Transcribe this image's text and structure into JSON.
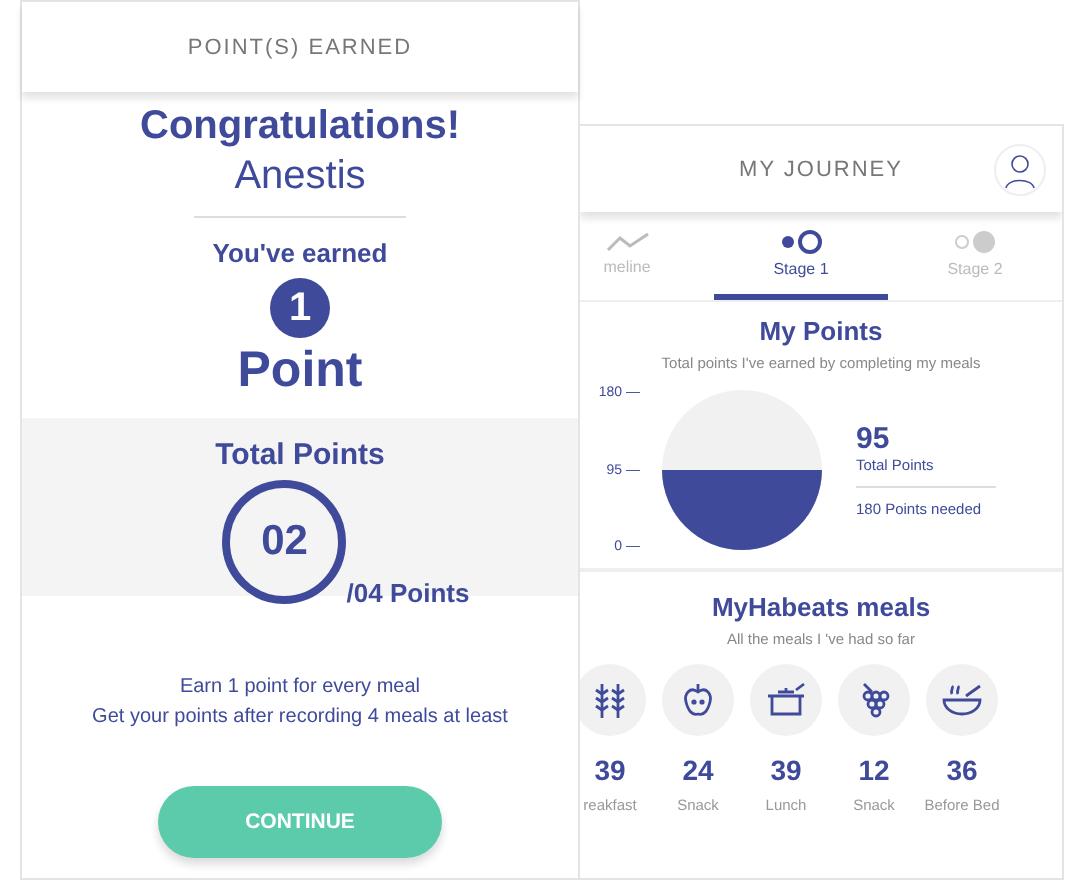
{
  "earned_card": {
    "header": "POINT(S) EARNED",
    "title": "Congratulations!",
    "name": "Anestis",
    "earned_label": "You've earned",
    "earned_count": "1",
    "earned_unit": "Point",
    "total": {
      "title": "Total Points",
      "value": "02",
      "suffix": "/04 Points"
    },
    "info": [
      "Earn 1 point for every meal",
      "Get your points after recording 4 meals at least"
    ],
    "button": "CONTINUE"
  },
  "journey_card": {
    "header": "MY JOURNEY",
    "tabs": [
      {
        "label": "meline",
        "selected": false
      },
      {
        "label": "Stage 1",
        "selected": true
      },
      {
        "label": "Stage 2",
        "selected": false
      }
    ],
    "points": {
      "title": "My Points",
      "subtitle": "Total points I've earned by completing my meals",
      "axis": [
        "180 —",
        "95 —",
        "0 —"
      ],
      "value": "95",
      "value_label": "Total Points",
      "needed": "180 Points needed"
    },
    "meals": {
      "title": "MyHabeats meals",
      "subtitle": "All the meals I 've had so far",
      "items": [
        {
          "count": "39",
          "label": "reakfast"
        },
        {
          "count": "24",
          "label": "Snack"
        },
        {
          "count": "39",
          "label": "Lunch"
        },
        {
          "count": "12",
          "label": "Snack"
        },
        {
          "count": "36",
          "label": "Before Bed"
        }
      ]
    }
  }
}
